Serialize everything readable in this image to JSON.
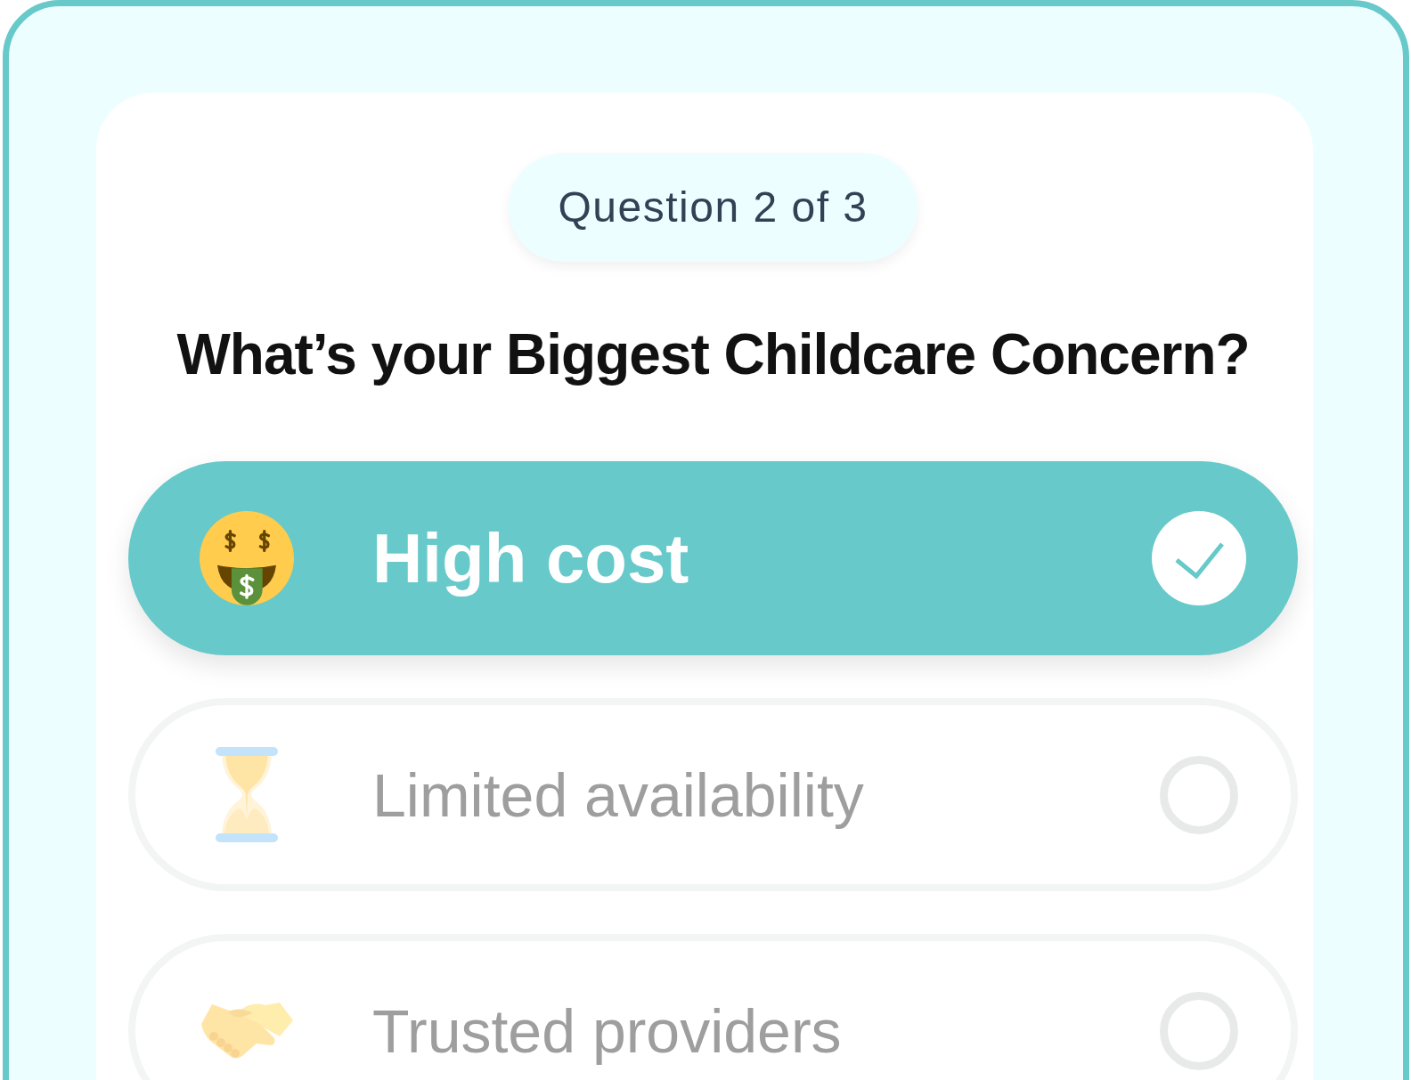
{
  "progress_label": "Question 2 of 3",
  "question": "What’s your Biggest Childcare Concern?",
  "options": [
    {
      "label": "High cost",
      "kind": "money",
      "selected": true
    },
    {
      "label": "Limited availability",
      "kind": "hourglass",
      "selected": false
    },
    {
      "label": "Trusted providers",
      "kind": "handshake",
      "selected": false
    }
  ]
}
